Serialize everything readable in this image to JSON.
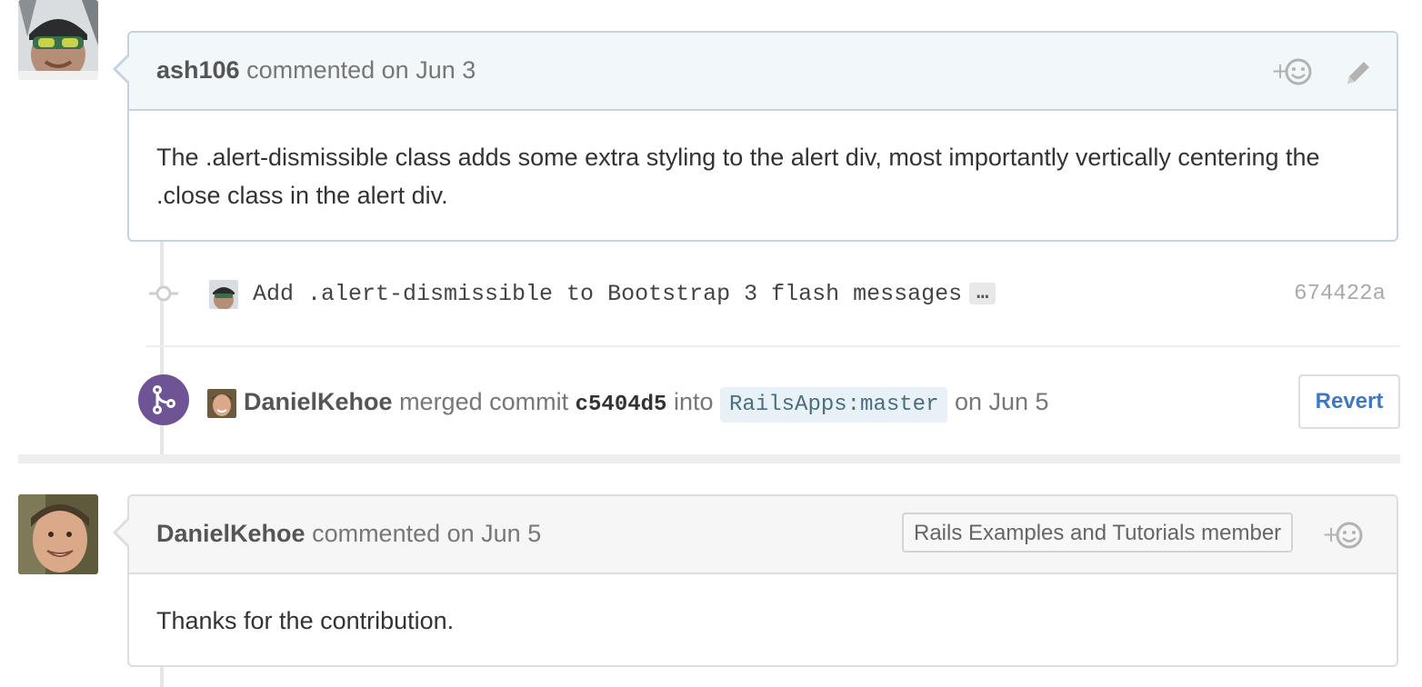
{
  "comments": [
    {
      "author": "ash106",
      "meta": "commented on Jun 3",
      "body": "The .alert-dismissible class adds some extra styling to the alert div, most importantly vertically centering the .close class in the alert div.",
      "reaction_icon": "plus-smiley-icon",
      "edit_icon": "pencil-icon"
    },
    {
      "author": "DanielKehoe",
      "meta": "commented on Jun 5",
      "badge": "Rails Examples and Tutorials member",
      "body": "Thanks for the contribution.",
      "reaction_icon": "plus-smiley-icon"
    }
  ],
  "commit": {
    "message": "Add .alert-dismissible to Bootstrap 3 flash messages",
    "ellipsis": "…",
    "sha": "674422a"
  },
  "merge": {
    "author": "DanielKehoe",
    "verb": "merged commit",
    "sha": "c5404d5",
    "into": "into",
    "branch": "RailsApps:master",
    "date": "on Jun 5",
    "revert_label": "Revert",
    "badge_color": "#6e5494"
  },
  "colors": {
    "link": "#4078c0",
    "merge_purple": "#6e5494"
  }
}
